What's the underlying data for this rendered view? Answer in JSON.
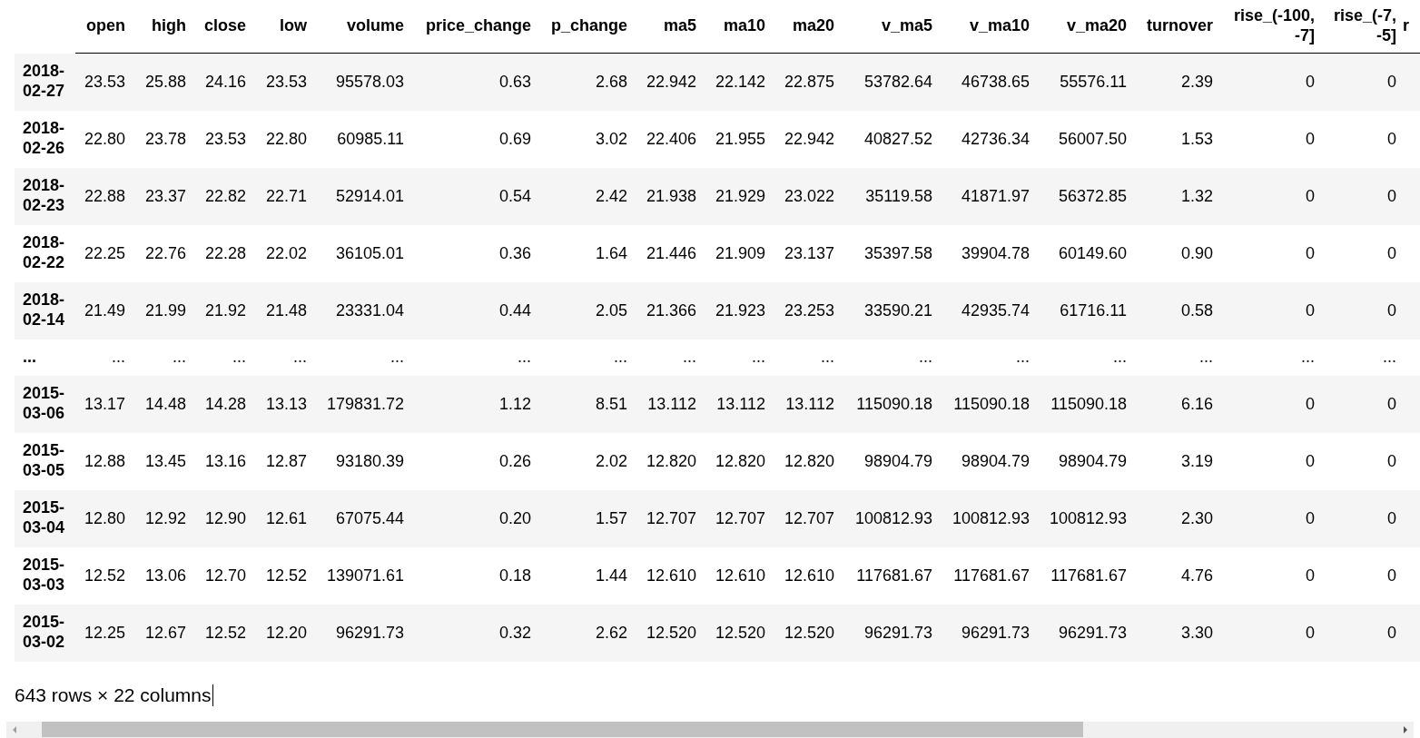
{
  "table": {
    "columns": [
      "open",
      "high",
      "close",
      "low",
      "volume",
      "price_change",
      "p_change",
      "ma5",
      "ma10",
      "ma20",
      "v_ma5",
      "v_ma10",
      "v_ma20",
      "turnover",
      "rise_(-100, -7]",
      "rise_(-7, -5]",
      "r"
    ],
    "rows": [
      {
        "kind": "data",
        "index": "2018-02-27",
        "cells": [
          "23.53",
          "25.88",
          "24.16",
          "23.53",
          "95578.03",
          "0.63",
          "2.68",
          "22.942",
          "22.142",
          "22.875",
          "53782.64",
          "46738.65",
          "55576.11",
          "2.39",
          "0",
          "0"
        ]
      },
      {
        "kind": "data",
        "index": "2018-02-26",
        "cells": [
          "22.80",
          "23.78",
          "23.53",
          "22.80",
          "60985.11",
          "0.69",
          "3.02",
          "22.406",
          "21.955",
          "22.942",
          "40827.52",
          "42736.34",
          "56007.50",
          "1.53",
          "0",
          "0"
        ]
      },
      {
        "kind": "data",
        "index": "2018-02-23",
        "cells": [
          "22.88",
          "23.37",
          "22.82",
          "22.71",
          "52914.01",
          "0.54",
          "2.42",
          "21.938",
          "21.929",
          "23.022",
          "35119.58",
          "41871.97",
          "56372.85",
          "1.32",
          "0",
          "0"
        ]
      },
      {
        "kind": "data",
        "index": "2018-02-22",
        "cells": [
          "22.25",
          "22.76",
          "22.28",
          "22.02",
          "36105.01",
          "0.36",
          "1.64",
          "21.446",
          "21.909",
          "23.137",
          "35397.58",
          "39904.78",
          "60149.60",
          "0.90",
          "0",
          "0"
        ]
      },
      {
        "kind": "data",
        "index": "2018-02-14",
        "cells": [
          "21.49",
          "21.99",
          "21.92",
          "21.48",
          "23331.04",
          "0.44",
          "2.05",
          "21.366",
          "21.923",
          "23.253",
          "33590.21",
          "42935.74",
          "61716.11",
          "0.58",
          "0",
          "0"
        ]
      },
      {
        "kind": "ellipsis",
        "index": "...",
        "cells": [
          "...",
          "...",
          "...",
          "...",
          "...",
          "...",
          "...",
          "...",
          "...",
          "...",
          "...",
          "...",
          "...",
          "...",
          "...",
          "..."
        ]
      },
      {
        "kind": "data",
        "index": "2015-03-06",
        "cells": [
          "13.17",
          "14.48",
          "14.28",
          "13.13",
          "179831.72",
          "1.12",
          "8.51",
          "13.112",
          "13.112",
          "13.112",
          "115090.18",
          "115090.18",
          "115090.18",
          "6.16",
          "0",
          "0"
        ]
      },
      {
        "kind": "data",
        "index": "2015-03-05",
        "cells": [
          "12.88",
          "13.45",
          "13.16",
          "12.87",
          "93180.39",
          "0.26",
          "2.02",
          "12.820",
          "12.820",
          "12.820",
          "98904.79",
          "98904.79",
          "98904.79",
          "3.19",
          "0",
          "0"
        ]
      },
      {
        "kind": "data",
        "index": "2015-03-04",
        "cells": [
          "12.80",
          "12.92",
          "12.90",
          "12.61",
          "67075.44",
          "0.20",
          "1.57",
          "12.707",
          "12.707",
          "12.707",
          "100812.93",
          "100812.93",
          "100812.93",
          "2.30",
          "0",
          "0"
        ]
      },
      {
        "kind": "data",
        "index": "2015-03-03",
        "cells": [
          "12.52",
          "13.06",
          "12.70",
          "12.52",
          "139071.61",
          "0.18",
          "1.44",
          "12.610",
          "12.610",
          "12.610",
          "117681.67",
          "117681.67",
          "117681.67",
          "4.76",
          "0",
          "0"
        ]
      },
      {
        "kind": "data",
        "index": "2015-03-02",
        "cells": [
          "12.25",
          "12.67",
          "12.52",
          "12.20",
          "96291.73",
          "0.32",
          "2.62",
          "12.520",
          "12.520",
          "12.520",
          "96291.73",
          "96291.73",
          "96291.73",
          "3.30",
          "0",
          "0"
        ]
      }
    ]
  },
  "summary": "643 rows × 22 columns"
}
